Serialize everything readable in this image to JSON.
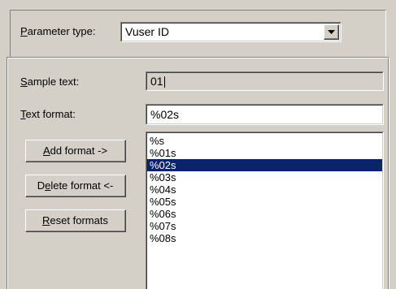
{
  "parameter_type": {
    "label_prefix": "",
    "label_accel": "P",
    "label_rest": "arameter type:",
    "value": "Vuser ID"
  },
  "sample_text": {
    "label_accel": "S",
    "label_rest": "ample text:",
    "value": "01"
  },
  "text_format": {
    "label_accel": "T",
    "label_rest": "ext format:",
    "value": "%02s"
  },
  "buttons": {
    "add_accel": "A",
    "add_rest": "dd format ->",
    "delete_pre": "D",
    "delete_accel": "e",
    "delete_rest": "lete format <-",
    "reset_accel": "R",
    "reset_rest": "eset formats"
  },
  "format_list": {
    "items": [
      "%s",
      "%01s",
      "%02s",
      "%03s",
      "%04s",
      "%05s",
      "%06s",
      "%07s",
      "%08s"
    ],
    "selected": "%02s"
  },
  "icons": {
    "dropdown_arrow": "chevron-down-icon"
  }
}
